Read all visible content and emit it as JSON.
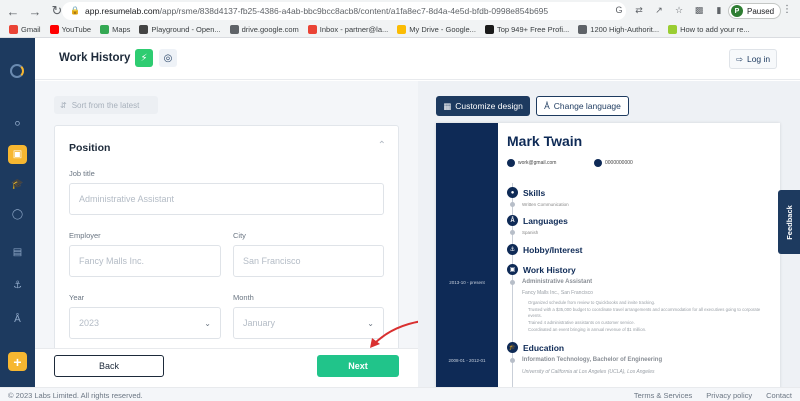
{
  "browser": {
    "url_host": "app.resumelab.com",
    "url_path": "/app/rsme/838d4137-fb25-4386-a4ab-bbc9bcc8acb8/content/a1fa8ec7-8d4a-4e5d-bfdb-0998e854b695",
    "profile_initial": "P",
    "profile_status": "Paused"
  },
  "bookmarks": [
    {
      "label": "Gmail",
      "color": "#ea4335"
    },
    {
      "label": "YouTube",
      "color": "#ff0000"
    },
    {
      "label": "Maps",
      "color": "#34a853"
    },
    {
      "label": "Playground - Open...",
      "color": "#444444"
    },
    {
      "label": "drive.google.com",
      "color": "#5f6368"
    },
    {
      "label": "Inbox - partner@la...",
      "color": "#ea4335"
    },
    {
      "label": "My Drive - Google...",
      "color": "#fbbc04"
    },
    {
      "label": "Top 949+ Free Profi...",
      "color": "#1a1a1a"
    },
    {
      "label": "1200 High-Authorit...",
      "color": "#5f6368"
    },
    {
      "label": "How to add your re...",
      "color": "#9acd32"
    }
  ],
  "header": {
    "title": "Work History",
    "login_label": "Log in"
  },
  "form": {
    "sort_label": "Sort from the latest",
    "section_title": "Position",
    "job_title_label": "Job title",
    "job_title_placeholder": "Administrative Assistant",
    "employer_label": "Employer",
    "employer_placeholder": "Fancy Malls Inc.",
    "city_label": "City",
    "city_placeholder": "San Francisco",
    "year_label": "Year",
    "year_value": "2023",
    "month_label": "Month",
    "month_value": "January",
    "back_label": "Back",
    "next_label": "Next"
  },
  "preview": {
    "customize_label": "Customize design",
    "language_label": "Change language",
    "resume": {
      "name": "Mark Twain",
      "email": "work@gmail.com",
      "phone": "0000000000",
      "skills_title": "Skills",
      "skills_item": "Written Communication",
      "languages_title": "Languages",
      "languages_item": "Spanish",
      "hobby_title": "Hobby/Interest",
      "work_title": "Work History",
      "work_date": "2013-10 - present",
      "work_job": "Administrative Assistant",
      "work_company": "Fancy Malls Inc., San Francisco",
      "work_bullets": [
        "Organized schedule from review to Quickbooks and invite tracking.",
        "Trusted with a $35,000 budget to coordinate travel arrangements and accommodation for all executives going to corporate events.",
        "Trained 4 administrative assistants on customer service.",
        "Coordinated an event bringing in annual revenue of $1 million."
      ],
      "education_title": "Education",
      "edu_date": "2008-01 - 2012-01",
      "edu_degree": "Information Technology, Bachelor of Engineering",
      "edu_school": "University of California at Los Angeles (UCLA), Los Angeles"
    }
  },
  "feedback_label": "Feedback",
  "footer": {
    "copyright": "© 2023 Labs Limited. All rights reserved.",
    "links": [
      "Terms & Services",
      "Privacy policy",
      "Contact"
    ]
  },
  "colors": {
    "nav": "#1d3a5f",
    "accent": "#f7b731",
    "next": "#21c48a",
    "resume_navy": "#0e2a56"
  }
}
